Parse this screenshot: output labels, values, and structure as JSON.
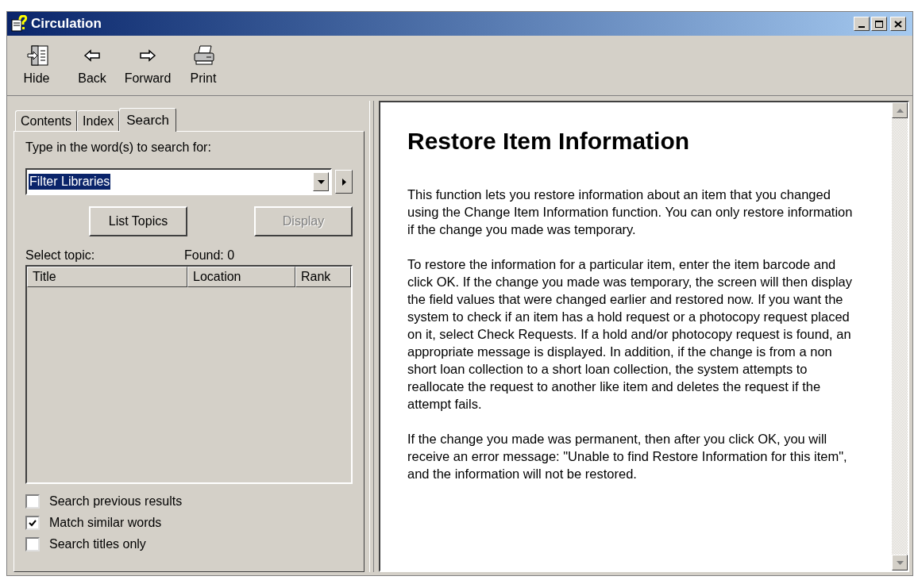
{
  "window": {
    "title": "Circulation"
  },
  "toolbar": [
    {
      "kind": "hide",
      "label": "Hide"
    },
    {
      "kind": "back",
      "label": "Back"
    },
    {
      "kind": "forward",
      "label": "Forward"
    },
    {
      "kind": "print",
      "label": "Print"
    }
  ],
  "tabs": [
    {
      "label": "Contents",
      "selected": false
    },
    {
      "label": "Index",
      "selected": false
    },
    {
      "label": "Search",
      "selected": true
    }
  ],
  "search": {
    "prompt": "Type in the word(s) to search for:",
    "value": "Filter Libraries",
    "list_topics": "List Topics",
    "display": {
      "label": "Display",
      "disabled": true
    },
    "select_topic": "Select topic:",
    "found": "Found: 0"
  },
  "table": {
    "columns": [
      "Title",
      "Location",
      "Rank"
    ]
  },
  "options": [
    {
      "label": "Search previous results",
      "checked": false
    },
    {
      "label": "Match similar words",
      "checked": true
    },
    {
      "label": "Search titles only",
      "checked": false
    }
  ],
  "article": {
    "title": "Restore Item Information",
    "paragraphs": [
      "This function lets you restore information about an item that you changed using the Change Item Information function. You can only restore information if the change you made was temporary.",
      "To restore the information for a particular item, enter the item barcode and click OK. If the change you made was temporary, the screen will then display the field values that were changed earlier and restored now. If you want the system to check if an item has a hold request or a photocopy request placed on it, select Check Requests. If a hold and/or photocopy request is found, an appropriate message is displayed. In addition, if the change is from a non short loan collection to a short loan collection, the system attempts to reallocate the request to another like item and deletes the request if the attempt fails.",
      "If the change you made was permanent, then after you click OK, you will receive an error message: \"Unable to find Restore Information for this item\", and the information will not be restored."
    ]
  }
}
